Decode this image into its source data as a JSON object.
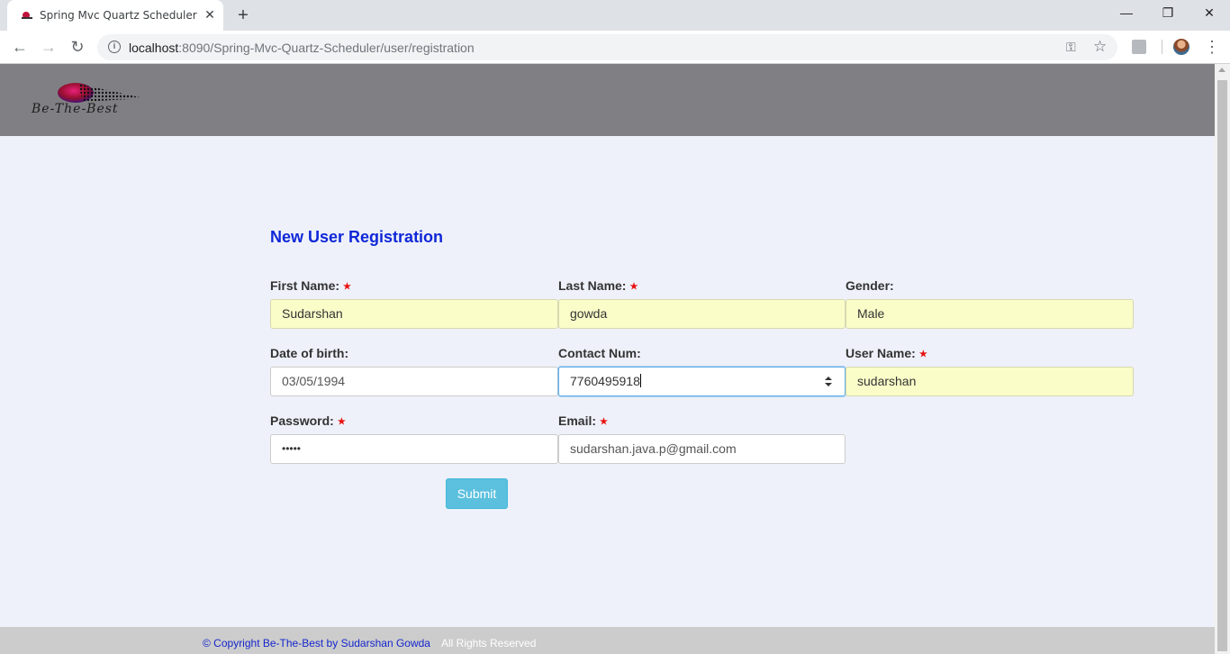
{
  "browser": {
    "tab_title": "Spring Mvc Quartz Scheduler",
    "tab_close": "✕",
    "new_tab": "+",
    "url_host": "localhost",
    "url_path": ":8090/Spring-Mvc-Quartz-Scheduler/user/registration",
    "window_minimize": "—",
    "window_restore": "❐",
    "window_close": "✕"
  },
  "header": {
    "logo_text": "Be-The-Best"
  },
  "form": {
    "title": "New User Registration",
    "required_mark": "★",
    "first_name": {
      "label": "First Name:",
      "value": "Sudarshan"
    },
    "last_name": {
      "label": "Last Name:",
      "value": "gowda"
    },
    "gender": {
      "label": "Gender:",
      "value": "Male"
    },
    "dob": {
      "label": "Date of birth:",
      "value": "03/05/1994"
    },
    "contact": {
      "label": "Contact Num:",
      "value": "7760495918"
    },
    "username": {
      "label": "User Name:",
      "value": "sudarshan"
    },
    "password": {
      "label": "Password:",
      "value": "•••••"
    },
    "email": {
      "label": "Email:",
      "value": "sudarshan.java.p@gmail.com"
    },
    "submit_label": "Submit"
  },
  "footer": {
    "copyright": "© Copyright Be-The-Best by Sudarshan Gowda",
    "rights": "All Rights Reserved"
  },
  "colors": {
    "title": "#0f27d8",
    "autofill": "#fafdc8",
    "submit": "#5bc0de",
    "header_bg": "#808084",
    "page_bg": "#eef1f9"
  }
}
